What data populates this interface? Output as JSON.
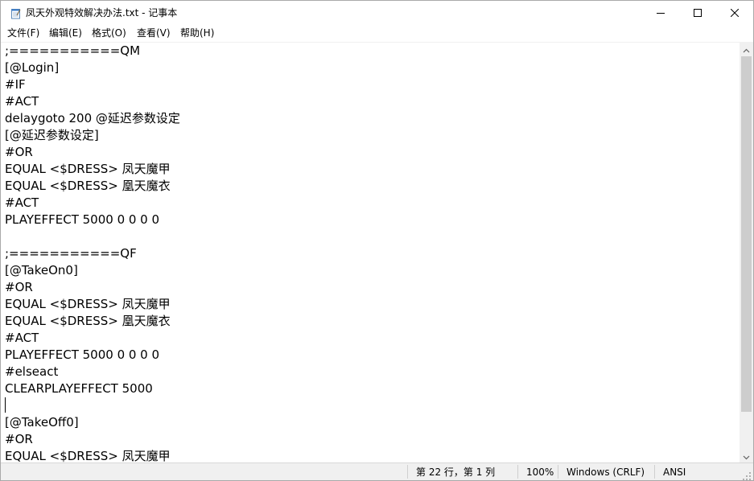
{
  "window": {
    "title": "凤天外观特效解决办法.txt - 记事本"
  },
  "menu": {
    "items": [
      {
        "label": "文件(F)"
      },
      {
        "label": "编辑(E)"
      },
      {
        "label": "格式(O)"
      },
      {
        "label": "查看(V)"
      },
      {
        "label": "帮助(H)"
      }
    ]
  },
  "editor": {
    "lines": [
      ";===========QM",
      "[@Login]",
      "#IF",
      "#ACT",
      "delaygoto 200 @延迟参数设定",
      "[@延迟参数设定]",
      "#OR",
      "EQUAL <$DRESS> 凤天魔甲",
      "EQUAL <$DRESS> 凰天魔衣",
      "#ACT",
      "PLAYEFFECT 5000 0 0 0 0",
      "",
      ";===========QF",
      "[@TakeOn0]",
      "#OR",
      "EQUAL <$DRESS> 凤天魔甲",
      "EQUAL <$DRESS> 凰天魔衣",
      "#ACT",
      "PLAYEFFECT 5000 0 0 0 0",
      "#elseact",
      "CLEARPLAYEFFECT 5000",
      "",
      "[@TakeOff0]",
      "#OR",
      "EQUAL <$DRESS> 凤天魔甲"
    ]
  },
  "status": {
    "position": "第 22 行，第 1 列",
    "zoom": "100%",
    "line_ending": "Windows (CRLF)",
    "encoding": "ANSI"
  },
  "icons": {
    "app": "notepad-icon",
    "minimize": "minimize-icon",
    "maximize": "maximize-icon",
    "close": "close-icon"
  }
}
